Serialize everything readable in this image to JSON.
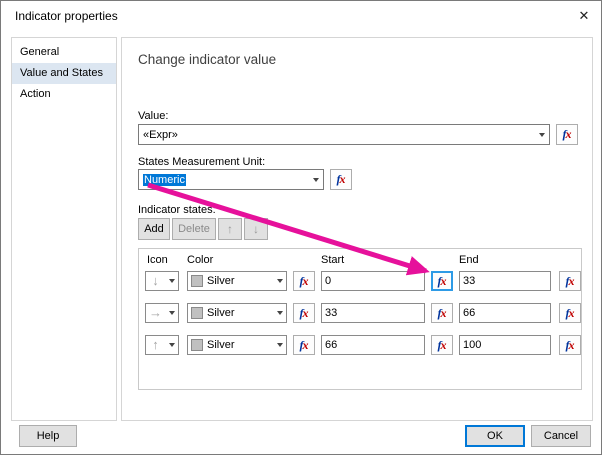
{
  "dialog": {
    "title": "Indicator properties",
    "close_glyph": "✕"
  },
  "sidebar": {
    "items": [
      {
        "label": "General"
      },
      {
        "label": "Value and States"
      },
      {
        "label": "Action"
      }
    ]
  },
  "main": {
    "heading": "Change indicator value",
    "value": {
      "label": "Value:",
      "selected": "«Expr»"
    },
    "unit": {
      "label": "States Measurement Unit:",
      "selected": "Numeric"
    },
    "states": {
      "label": "Indicator states:",
      "add": "Add",
      "delete": "Delete",
      "up_glyph": "↑",
      "down_glyph": "↓",
      "headers": {
        "icon": "Icon",
        "color": "Color",
        "start": "Start",
        "end": "End"
      },
      "rows": [
        {
          "icon_glyph": "↓",
          "color": "Silver",
          "start": "0",
          "end": "33"
        },
        {
          "icon_glyph": "→",
          "color": "Silver",
          "start": "33",
          "end": "66"
        },
        {
          "icon_glyph": "↑",
          "color": "Silver",
          "start": "66",
          "end": "100"
        }
      ]
    },
    "fx": {
      "f": "f",
      "x": "x"
    }
  },
  "footer": {
    "help": "Help",
    "ok": "OK",
    "cancel": "Cancel"
  },
  "colors": {
    "accent": "#0078d7",
    "selection": "#0078d7",
    "annotation": "#e6119b",
    "silver": "#c0c0c0"
  }
}
